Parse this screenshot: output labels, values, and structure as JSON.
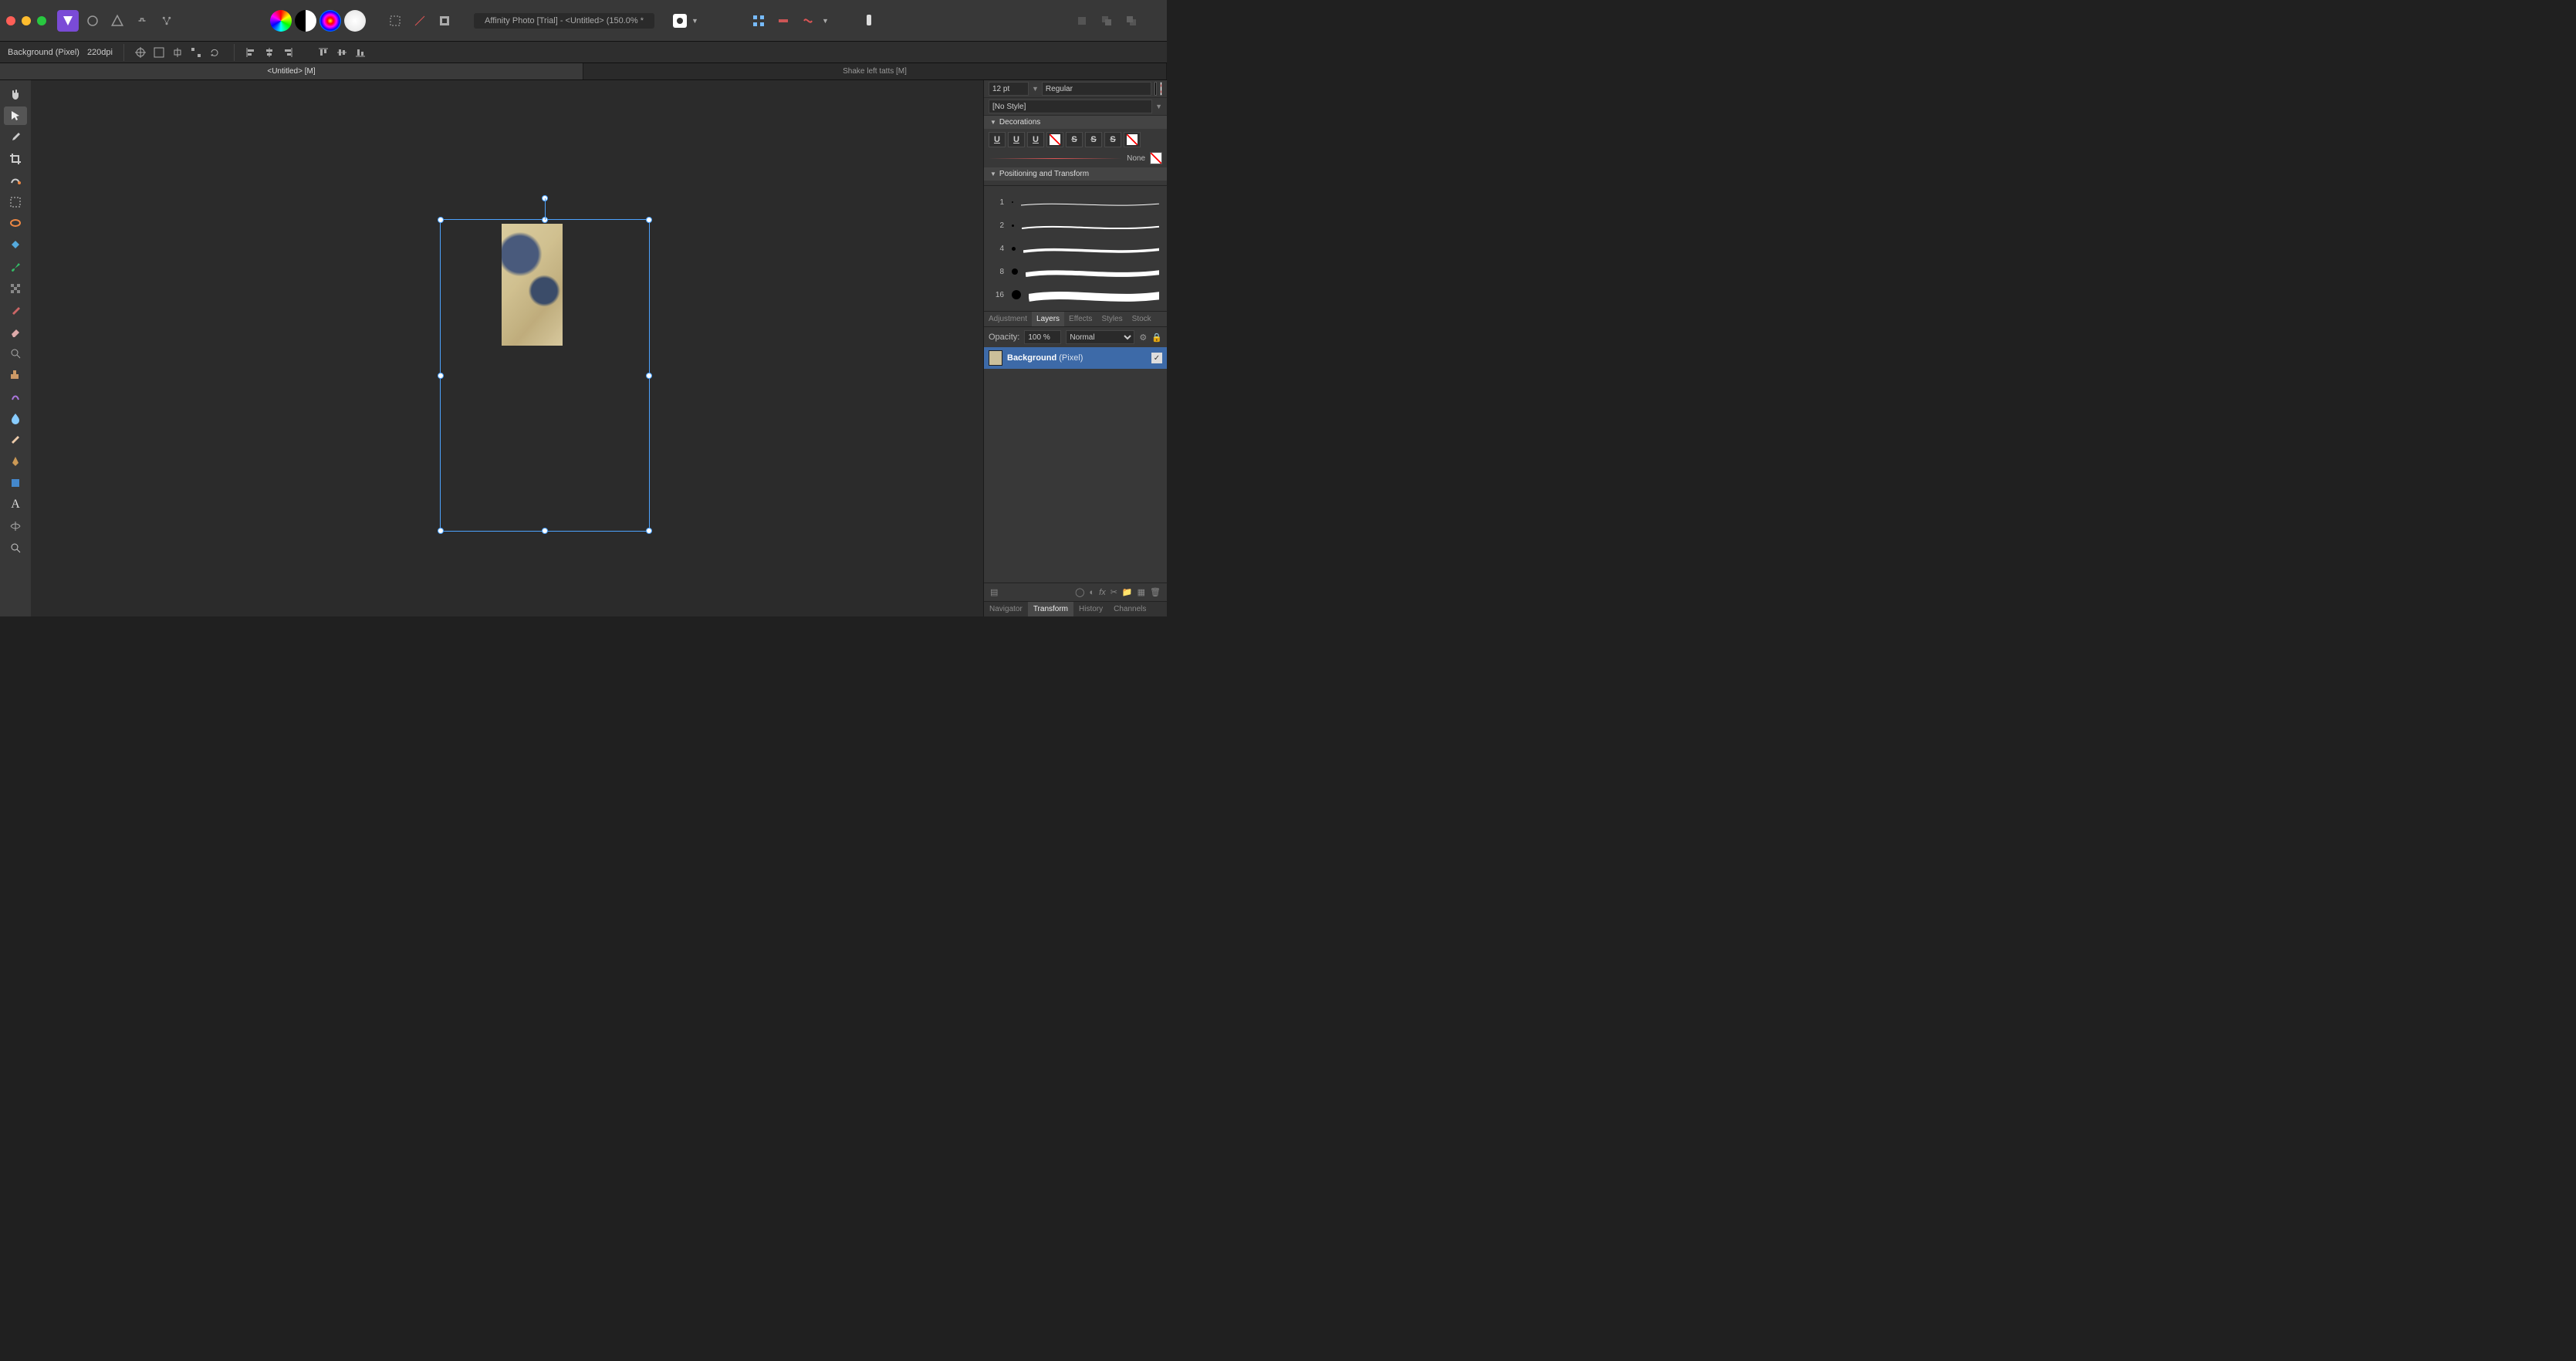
{
  "title_pill": "Affinity Photo [Trial] - <Untitled> (150.0% *",
  "font": {
    "size": "12 pt",
    "weight": "Regular",
    "style": "[No Style]"
  },
  "decorations_header": "Decorations",
  "decorations": {
    "none_label": "None"
  },
  "positioning_header": "Positioning and Transform",
  "brush_sizes": [
    "1",
    "2",
    "4",
    "8",
    "16"
  ],
  "panel_tabs": [
    "Adjustment",
    "Layers",
    "Effects",
    "Styles",
    "Stock"
  ],
  "panel_tabs_selected": 1,
  "opacity_label": "Opacity:",
  "opacity_value": "100 %",
  "blend_mode": "Normal",
  "layer": {
    "name": "Background",
    "type": "(Pixel)"
  },
  "footer_tabs": [
    "Navigator",
    "Transform",
    "History",
    "Channels"
  ],
  "footer_tabs_selected": 1,
  "context": {
    "layer_label": "Background (Pixel)",
    "dpi": "220dpi"
  },
  "doc_tabs": [
    "<Untitled> [M]",
    "Shake left tatts [M]"
  ],
  "active_doc_tab": 0
}
